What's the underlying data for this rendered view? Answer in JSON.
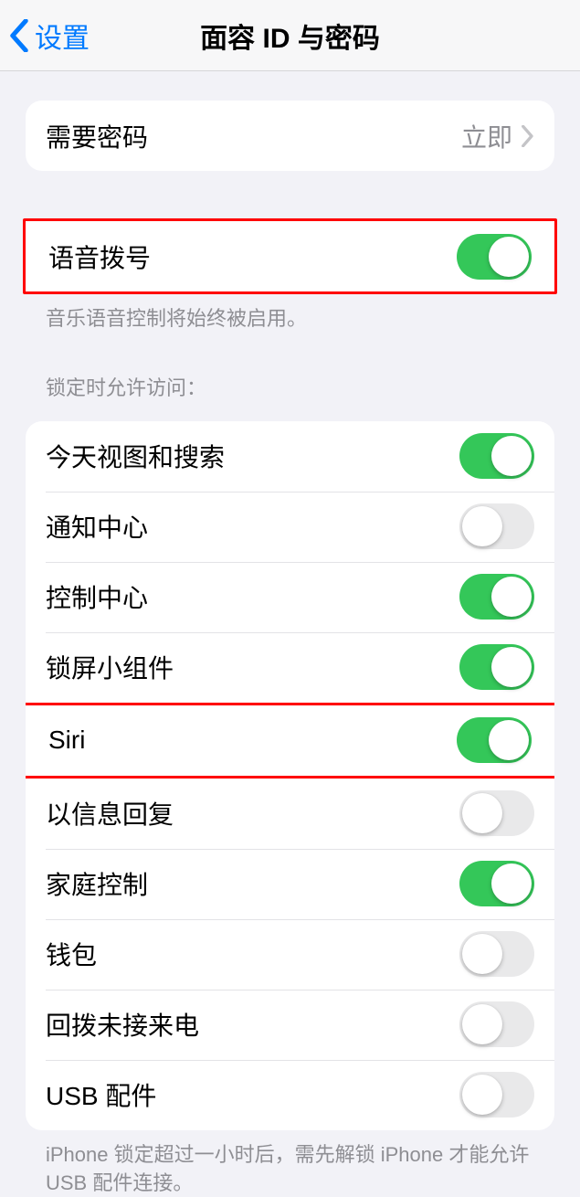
{
  "nav": {
    "back_label": "设置",
    "title": "面容 ID 与密码"
  },
  "require_passcode": {
    "label": "需要密码",
    "value": "立即"
  },
  "voice_dial": {
    "label": "语音拨号",
    "on": true,
    "footer": "音乐语音控制将始终被启用。"
  },
  "lock_access": {
    "header": "锁定时允许访问：",
    "items": [
      {
        "label": "今天视图和搜索",
        "on": true
      },
      {
        "label": "通知中心",
        "on": false
      },
      {
        "label": "控制中心",
        "on": true
      },
      {
        "label": "锁屏小组件",
        "on": true
      },
      {
        "label": "Siri",
        "on": true
      },
      {
        "label": "以信息回复",
        "on": false
      },
      {
        "label": "家庭控制",
        "on": true
      },
      {
        "label": "钱包",
        "on": false
      },
      {
        "label": "回拨未接来电",
        "on": false
      },
      {
        "label": "USB 配件",
        "on": false
      }
    ],
    "footer": "iPhone 锁定超过一小时后，需先解锁 iPhone 才能允许 USB 配件连接。"
  },
  "annotations": {
    "highlighted_rows": [
      "语音拨号",
      "Siri"
    ]
  }
}
